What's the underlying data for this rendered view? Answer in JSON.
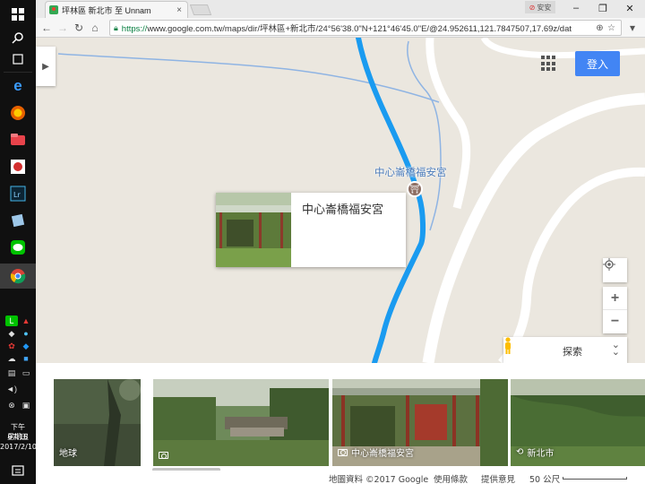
{
  "browser": {
    "tab_title": "坪林區 新北市 至 Unnam",
    "tab_close": "×",
    "profile_label": "安安",
    "url_scheme": "https://",
    "url_rest": "www.google.com.tw/maps/dir/坪林區+新北市/24°56'38.0\"N+121°46'45.0\"E/@24.952611,121.7847507,17.69z/dat"
  },
  "map": {
    "signin_label": "登入",
    "place_label": "中心崙橋福安宮",
    "info_card_title": "中心崙橋福安宮",
    "zoom_in": "+",
    "zoom_out": "−",
    "explore_label": "探索",
    "route_color": "#1a9bf0"
  },
  "photo_strip": {
    "thumbs": [
      {
        "label": "地球",
        "camera": false
      },
      {
        "label": "",
        "camera": true
      },
      {
        "label": "中心崙橋福安宮",
        "camera": true
      },
      {
        "label": "新北市",
        "camera": false
      }
    ]
  },
  "footer": {
    "map_data": "地圖資料 ©2017 Google",
    "terms": "使用條款",
    "feedback": "提供意見",
    "scale": "50 公尺"
  },
  "taskbar": {
    "time": "下午 07:18",
    "weekday": "星期五",
    "date": "2017/2/10"
  }
}
